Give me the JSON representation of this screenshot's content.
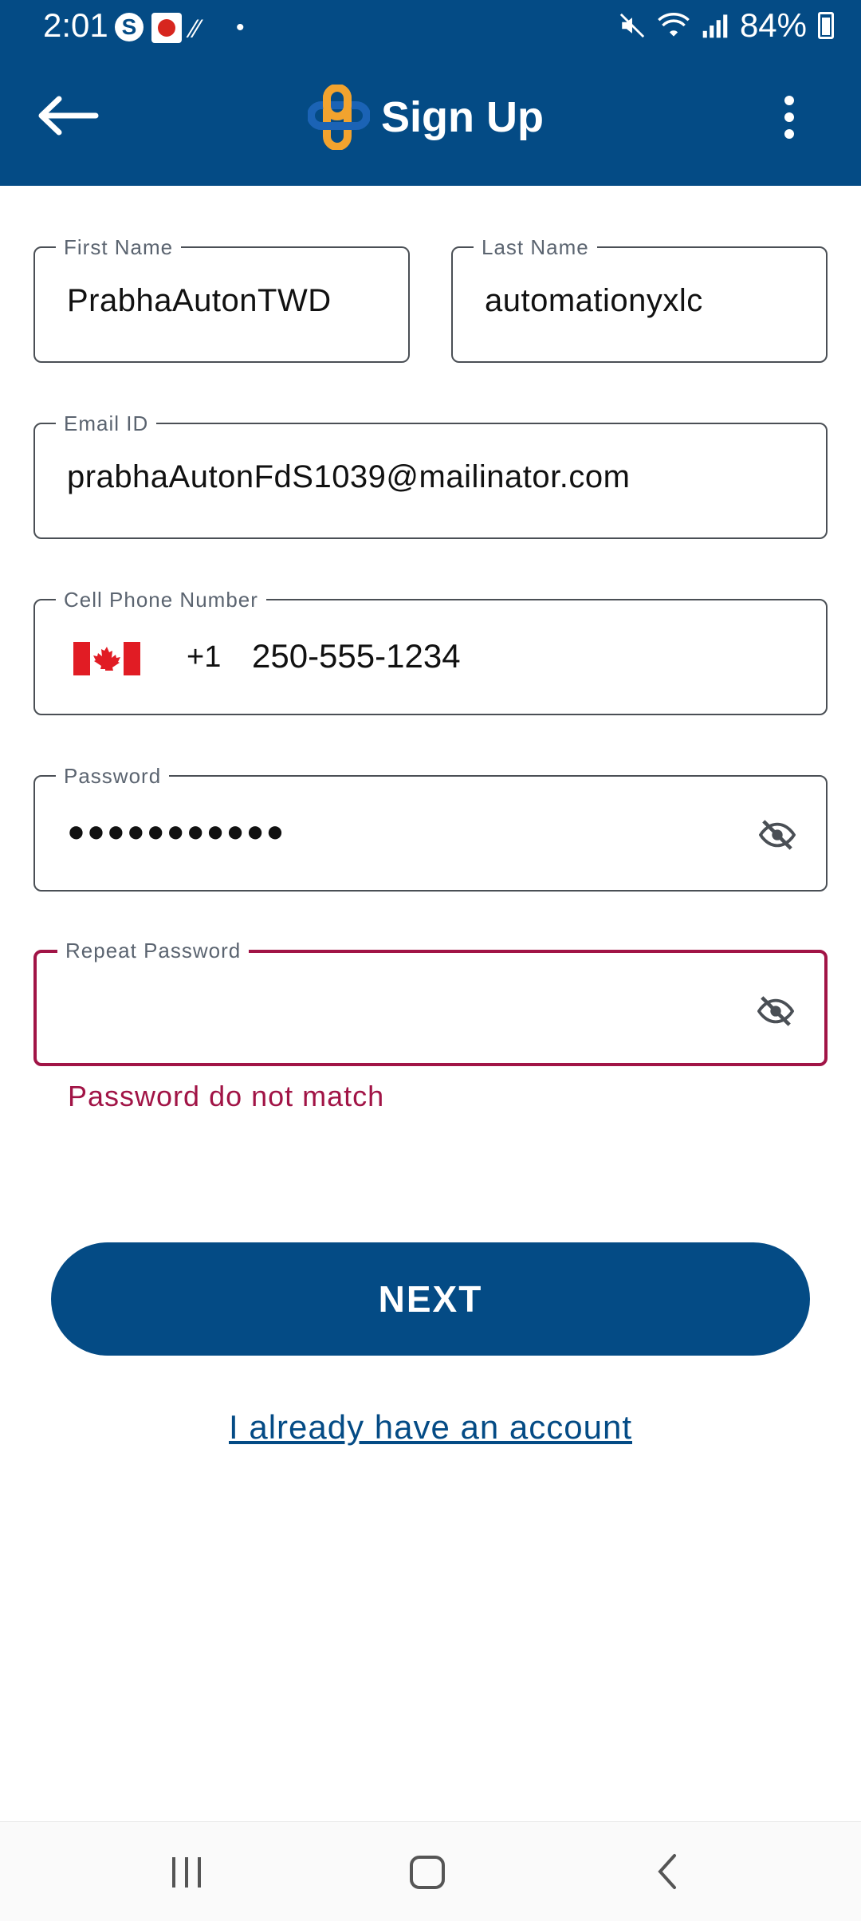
{
  "status_bar": {
    "time": "2:01",
    "battery": "84%",
    "skype_glyph": "S",
    "icons": [
      "skype-icon",
      "app-notification-icon",
      "signal-dots-icon",
      "mute-icon",
      "wifi-icon",
      "cell-signal-icon",
      "battery-icon"
    ]
  },
  "appbar": {
    "title": "Sign Up",
    "back_icon": "arrow-left-icon",
    "menu_icon": "more-vert-icon",
    "brand_colors": {
      "bar": "#044b85",
      "logo_orange": "#f2a32e",
      "logo_blue": "#1b63b5"
    }
  },
  "form": {
    "first_name": {
      "label": "First Name",
      "value": "PrabhaAutonTWD"
    },
    "last_name": {
      "label": "Last Name",
      "value": "automationyxlc"
    },
    "email": {
      "label": "Email ID",
      "value": "prabhaAutonFdS1039@mailinator.com"
    },
    "phone": {
      "label": "Cell Phone Number",
      "country_code": "+1",
      "value": "250-555-1234",
      "flag": "canada-flag-icon"
    },
    "password": {
      "label": "Password",
      "value": "●●●●●●●●●●●",
      "toggle_icon": "eye-off-icon"
    },
    "repeat_password": {
      "label": "Repeat Password",
      "value": "",
      "toggle_icon": "eye-off-icon",
      "error": "Password do not match",
      "error_color": "#a11446"
    }
  },
  "actions": {
    "next_label": "NEXT",
    "login_link": "I already have an account"
  },
  "navbar": {
    "icons": [
      "recent-apps-icon",
      "home-icon",
      "back-icon"
    ]
  }
}
